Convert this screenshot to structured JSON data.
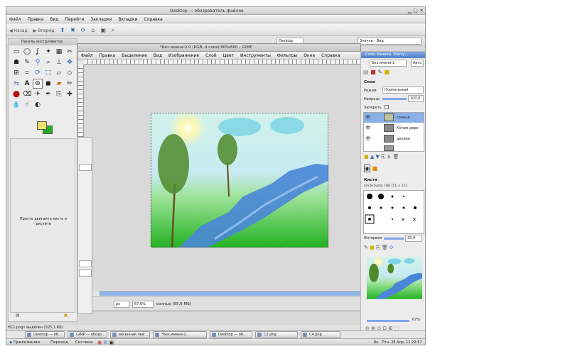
{
  "browser": {
    "title": "Desktop — обозреватель файлов",
    "menu": [
      "Файл",
      "Правка",
      "Вид",
      "Перейти",
      "Закладки",
      "Вкладки",
      "Справка"
    ],
    "back": "Назад",
    "forward": "Вперёд",
    "zoom_select": "Значки - Вид",
    "location": "Desktop",
    "status": "НС1.png» выделен (325,1 КБ)"
  },
  "toolbox": {
    "title": "Панель инструментов",
    "empty_hint": "Просто двигайте кисть и рисуйте"
  },
  "gimp": {
    "title": "*Без имени-2.0 (RGB, 4 слоя) 800x600 – GIMP",
    "menu": [
      "Файл",
      "Правка",
      "Выделение",
      "Вид",
      "Изображение",
      "Слой",
      "Цвет",
      "Инструменты",
      "Фильтры",
      "Окна",
      "Справка"
    ],
    "unit": "px",
    "zoom": "67,0%",
    "status": "солнце (95,6 МБ)"
  },
  "layers_dock": {
    "title": "Слои, Каналы, Конту…",
    "image_select": "Без имени-2",
    "auto_btn": "Авто",
    "section_title": "Слои",
    "mode_label": "Режим",
    "mode_value": "Нормальный",
    "opacity_label": "Непрозр",
    "opacity_value": "100,0",
    "lock_label": "Запереть",
    "layers": [
      {
        "name": "солнце"
      },
      {
        "name": "Копия дере"
      },
      {
        "name": "дерево"
      }
    ]
  },
  "brushes_dock": {
    "title": "Кисти",
    "brush_name": "Circle Fuzzy (19) (11 × 11)",
    "spacing_label": "Интервал",
    "spacing_value": "25,0"
  },
  "navigation": {
    "zoom_percent": "67%"
  },
  "taskbar": {
    "tasks": [
      "Desktop — об…",
      "GIMP — обозр…",
      "весенний пей…",
      "*Без имени-2…",
      "Desktop — об…",
      "С2.png",
      "С4.png"
    ]
  },
  "panel": {
    "apps": "Приложения",
    "places": "Переход",
    "system": "Система",
    "lang": "Ru",
    "clock": "Птн, 28 Апр, 11:22:57"
  },
  "colors": {
    "sky": "#c6eaf0",
    "grass": "#2fbf2f",
    "river": "#4a86d8",
    "fg_color": "#eae36a",
    "bg_color": "#22b022"
  }
}
